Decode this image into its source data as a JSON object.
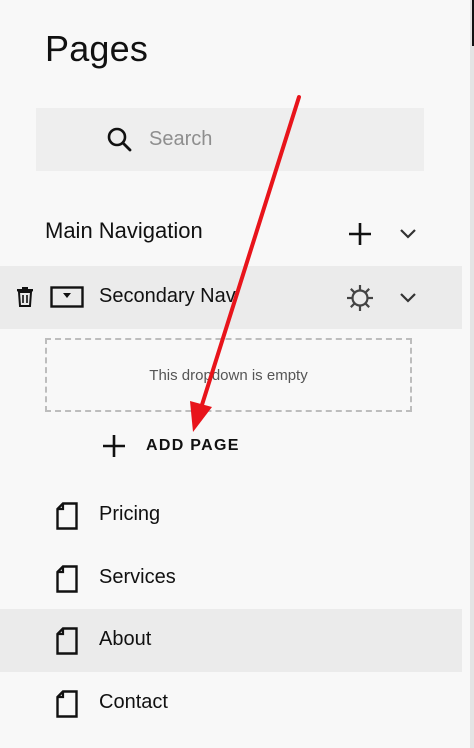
{
  "panel": {
    "title": "Pages"
  },
  "search": {
    "placeholder": "Search",
    "icon": "search-icon"
  },
  "main_navigation": {
    "label": "Main Navigation",
    "add_icon": "plus-icon",
    "collapse_icon": "chevron-down-icon"
  },
  "secondary_navigation": {
    "label": "Secondary Nav",
    "delete_icon": "trash-icon",
    "folder_icon": "dropdown-folder-icon",
    "settings_icon": "gear-icon",
    "collapse_icon": "chevron-down-icon"
  },
  "dropdown": {
    "empty_text": "This dropdown is empty"
  },
  "add_page": {
    "label": "ADD PAGE",
    "icon": "plus-icon"
  },
  "pages": [
    {
      "label": "Pricing",
      "icon": "page-icon",
      "active": false
    },
    {
      "label": "Services",
      "icon": "page-icon",
      "active": false
    },
    {
      "label": "About",
      "icon": "page-icon",
      "active": true
    },
    {
      "label": "Contact",
      "icon": "page-icon",
      "active": false
    }
  ],
  "annotation": {
    "color": "#e8141b"
  },
  "colors": {
    "background": "#f8f8f8",
    "selected_row": "#ebebeb",
    "search_bg": "#eeeeee"
  }
}
